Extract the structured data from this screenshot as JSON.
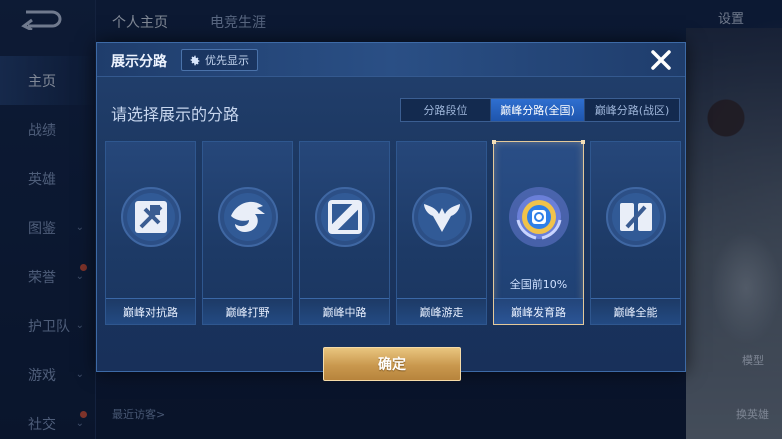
{
  "background": {
    "nav": [
      {
        "label": "主页",
        "active": true,
        "chevron": false,
        "dot": false
      },
      {
        "label": "战绩",
        "active": false,
        "chevron": false,
        "dot": false
      },
      {
        "label": "英雄",
        "active": false,
        "chevron": false,
        "dot": false
      },
      {
        "label": "图鉴",
        "active": false,
        "chevron": true,
        "dot": false
      },
      {
        "label": "荣誉",
        "active": false,
        "chevron": true,
        "dot": true
      },
      {
        "label": "护卫队",
        "active": false,
        "chevron": true,
        "dot": false
      },
      {
        "label": "游戏",
        "active": false,
        "chevron": true,
        "dot": false
      },
      {
        "label": "社交",
        "active": false,
        "chevron": true,
        "dot": true
      }
    ],
    "tabs": [
      {
        "label": "个人主页",
        "active": true
      },
      {
        "label": "电竞生涯",
        "active": false
      }
    ],
    "settings_label": "设置",
    "model_label": "模型",
    "hero_label": "换英雄",
    "visitors_label": "最近访客>"
  },
  "modal": {
    "title": "展示分路",
    "preference_button": "优先显示",
    "subtitle": "请选择展示的分路",
    "segments": [
      {
        "label": "分路段位",
        "selected": false
      },
      {
        "label": "巅峰分路(全国)",
        "selected": true
      },
      {
        "label": "巅峰分路(战区)",
        "selected": false
      }
    ],
    "cards": [
      {
        "label": "巅峰对抗路",
        "icon": "swords-shield-icon",
        "rank": "",
        "selected": false
      },
      {
        "label": "巅峰打野",
        "icon": "dragon-icon",
        "rank": "",
        "selected": false
      },
      {
        "label": "巅峰中路",
        "icon": "mid-lane-icon",
        "rank": "",
        "selected": false
      },
      {
        "label": "巅峰游走",
        "icon": "wings-icon",
        "rank": "",
        "selected": false
      },
      {
        "label": "巅峰发育路",
        "icon": "marksman-emblem-icon",
        "rank": "全国前10%",
        "selected": true
      },
      {
        "label": "巅峰全能",
        "icon": "all-round-icon",
        "rank": "",
        "selected": false
      }
    ],
    "confirm_label": "确定"
  },
  "colors": {
    "accent_gold": "#e4c99a",
    "selected_tab": "#2f6fd0",
    "modal_bg": "#1b365f"
  }
}
